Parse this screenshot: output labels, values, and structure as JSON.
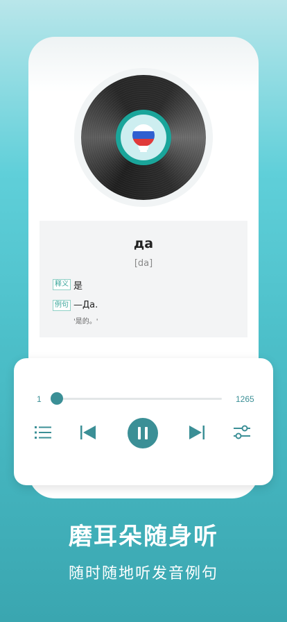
{
  "card": {
    "word": "да",
    "phonetic": "[da]",
    "meaning_tag": "释义",
    "meaning": "是",
    "example_tag": "例句",
    "example": "—Да.",
    "example_translation": "'是的。'"
  },
  "player": {
    "current": "1",
    "total": "1265",
    "progress_fraction": 0.0008,
    "accent": "#3b8f96"
  },
  "promo": {
    "headline": "磨耳朵随身听",
    "subtitle": "随时随地听发音例句"
  },
  "icons": {
    "list": "list-icon",
    "prev": "skip-previous-icon",
    "pause": "pause-icon",
    "next": "skip-next-icon",
    "settings": "sliders-icon",
    "flag": "russian-flag-bulb-icon"
  }
}
